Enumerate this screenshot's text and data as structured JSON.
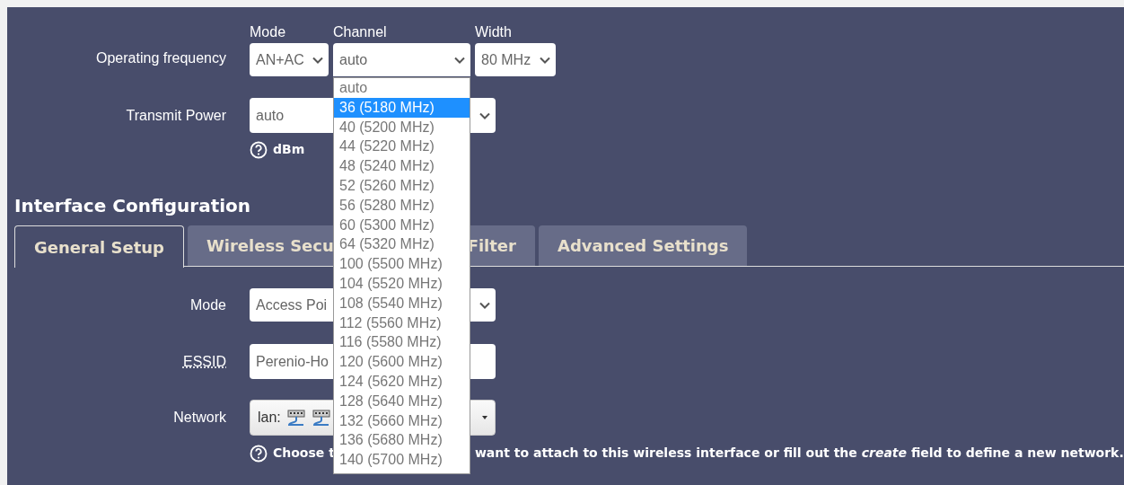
{
  "operating_frequency": {
    "label": "Operating frequency",
    "fields": [
      {
        "kind": "select",
        "heading": "Mode",
        "value": "AN+AC",
        "expanded": false
      },
      {
        "kind": "select",
        "heading": "Channel",
        "value": "auto",
        "expanded": true
      },
      {
        "kind": "select",
        "heading": "Width",
        "value": "80 MHz",
        "expanded": false
      }
    ]
  },
  "channel_options": [
    {
      "label": "auto",
      "selected": false
    },
    {
      "label": "36 (5180 MHz)",
      "selected": true
    },
    {
      "label": "40 (5200 MHz)",
      "selected": false
    },
    {
      "label": "44 (5220 MHz)",
      "selected": false
    },
    {
      "label": "48 (5240 MHz)",
      "selected": false
    },
    {
      "label": "52 (5260 MHz)",
      "selected": false
    },
    {
      "label": "56 (5280 MHz)",
      "selected": false
    },
    {
      "label": "60 (5300 MHz)",
      "selected": false
    },
    {
      "label": "64 (5320 MHz)",
      "selected": false
    },
    {
      "label": "100 (5500 MHz)",
      "selected": false
    },
    {
      "label": "104 (5520 MHz)",
      "selected": false
    },
    {
      "label": "108 (5540 MHz)",
      "selected": false
    },
    {
      "label": "112 (5560 MHz)",
      "selected": false
    },
    {
      "label": "116 (5580 MHz)",
      "selected": false
    },
    {
      "label": "120 (5600 MHz)",
      "selected": false
    },
    {
      "label": "124 (5620 MHz)",
      "selected": false
    },
    {
      "label": "128 (5640 MHz)",
      "selected": false
    },
    {
      "label": "132 (5660 MHz)",
      "selected": false
    },
    {
      "label": "136 (5680 MHz)",
      "selected": false
    },
    {
      "label": "140 (5700 MHz)",
      "selected": false
    }
  ],
  "transmit_power": {
    "label": "Transmit Power",
    "value": "auto",
    "help": "dBm"
  },
  "section_title": "Interface Configuration",
  "tabs": [
    {
      "label": "General Setup",
      "selected": true
    },
    {
      "label": "Wireless Secu",
      "selected": false
    },
    {
      "label": "Filter",
      "selected": false
    },
    {
      "label": "Advanced Settings",
      "selected": false
    }
  ],
  "general_setup": {
    "mode": {
      "label": "Mode",
      "value": "Access Poi"
    },
    "essid": {
      "label": "ESSID",
      "value": "Perenio-Ho"
    },
    "network": {
      "label": "Network",
      "value": "lan:",
      "help_parts": [
        "Choose t",
        "want to attach to this wireless interface or fill out the *create* field to define a new network."
      ]
    }
  }
}
